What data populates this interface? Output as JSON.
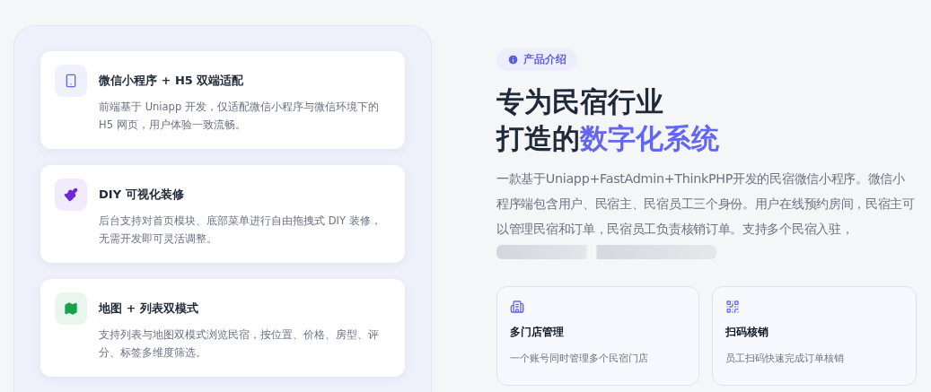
{
  "features": [
    {
      "title": "微信小程序 + H5 双端适配",
      "description": "前端基于 Uniapp 开发，仅适配微信小程序与微信环境下的 H5 网页，用户体验一致流畅。",
      "color": "#6366f1"
    },
    {
      "title": "DIY 可视化装修",
      "description": "后台支持对首页模块、底部菜单进行自由拖拽式 DIY 装修，无需开发即可灵活调整。",
      "color": "#6d28d9"
    },
    {
      "title": "地图 + 列表双模式",
      "description": "支持列表与地图双模式浏览民宿，按位置、价格、房型、评分、标签多维度筛选。",
      "color": "#16a34a"
    }
  ],
  "intro": {
    "badge": "产品介绍",
    "title_lines": [
      {
        "text": "专为民宿行业"
      },
      {
        "text": "打造的",
        "highlight": "数字化系统"
      }
    ],
    "description": "一款基于Uniapp+FastAdmin+ThinkPHP开发的民宿微信小程序。微信小程序端包含用户、民宿主、民宿员工三个身份。用户在线预约房间，民宿主可以管理民宿和订单，民宿员工负责核销订单。支持多个民宿入驻，",
    "highlights": [
      {
        "title": "多门店管理",
        "description": "一个账号同时管理多个民宿门店"
      },
      {
        "title": "扫码核销",
        "description": "员工扫码快速完成订单核销"
      }
    ]
  }
}
